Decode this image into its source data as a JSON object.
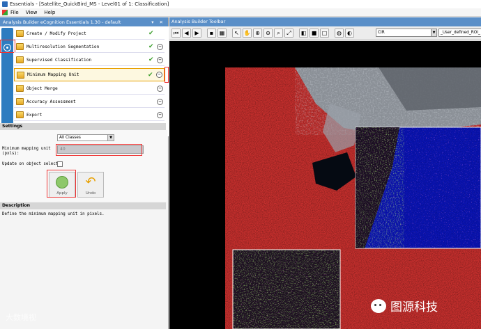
{
  "window": {
    "title": "Essentials - [Satellite_QuickBird_MS - Level01 of 1: Classification]"
  },
  "menu": {
    "items": [
      "File",
      "View",
      "Help"
    ]
  },
  "left_panel": {
    "title": "Analysis Builder eCognition Essentials 1.30 - default",
    "controls": "▾ ✕",
    "steps": [
      {
        "label": "Create / Modify Project",
        "done": "✔",
        "remove": ""
      },
      {
        "label": "Multiresolution Segmentation",
        "done": "✔",
        "remove": "−"
      },
      {
        "label": "Supervised Classification",
        "done": "✔",
        "remove": "−"
      },
      {
        "label": "Minimum Mapping Unit",
        "done": "✔",
        "remove": "−"
      },
      {
        "label": "Object Merge",
        "done": "",
        "remove": "−"
      },
      {
        "label": "Accuracy Assessment",
        "done": "",
        "remove": "−"
      },
      {
        "label": "Export",
        "done": "",
        "remove": "−"
      }
    ]
  },
  "settings": {
    "header": "Settings",
    "class_select": "All Classes",
    "mmu_label": "Minimum mapping unit (pxls):",
    "mmu_value": "40",
    "update_label": "Update on object select",
    "apply_label": "Apply",
    "undo_label": "Undo"
  },
  "description": {
    "header": "Description",
    "text": "Define the minimum mapping unit in pixels."
  },
  "toolbar": {
    "title": "Analysis Builder Toolbar",
    "layer_select": "CIR",
    "roi_select": "_User_defined_ROI_"
  },
  "watermarks": {
    "left": "大数境视",
    "right": "图源科技"
  },
  "colors": {
    "panel_header": "#5a8fc8",
    "step_rail": "#2d7cc0",
    "highlight": "#e33333",
    "active_step": "#e8a000"
  }
}
